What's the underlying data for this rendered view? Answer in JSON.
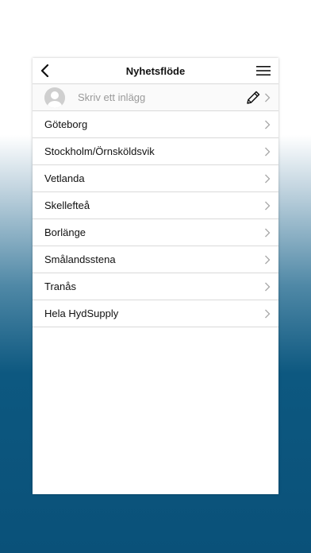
{
  "header": {
    "title": "Nyhetsflöde",
    "back_icon": "chevron-left-icon",
    "menu_icon": "hamburger-menu-icon"
  },
  "compose": {
    "placeholder": "Skriv ett inlägg",
    "avatar_icon": "user-avatar-icon",
    "edit_icon": "pencil-icon"
  },
  "feeds": [
    {
      "label": "Göteborg"
    },
    {
      "label": "Stockholm/Örnsköldsvik"
    },
    {
      "label": "Vetlanda"
    },
    {
      "label": "Skellefteå"
    },
    {
      "label": "Borlänge"
    },
    {
      "label": "Smålandsstena"
    },
    {
      "label": "Tranås"
    },
    {
      "label": "Hela HydSupply"
    }
  ],
  "colors": {
    "background_top": "#ffffff",
    "background_bottom": "#0a5179",
    "divider": "#d9d9d9",
    "chevron": "#a8a8a8"
  }
}
